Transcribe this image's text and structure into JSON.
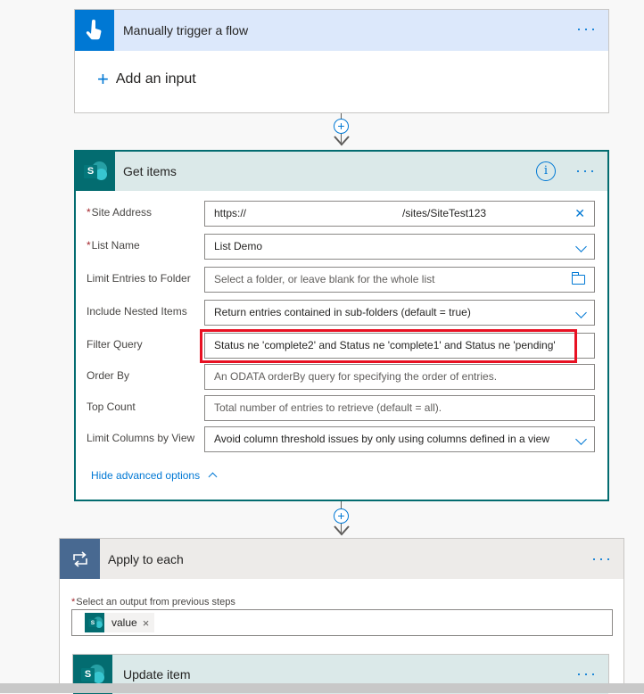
{
  "trigger": {
    "title": "Manually trigger a flow",
    "more": "···",
    "add_input_icon": "+",
    "add_input_label": "Add an input"
  },
  "connectors": {
    "plus": "+"
  },
  "get_items": {
    "title": "Get items",
    "info": "i",
    "more": "···",
    "fields": {
      "site_address": {
        "label": "Site Address",
        "value_prefix": "https://",
        "value_suffix": "/sites/SiteTest123"
      },
      "list_name": {
        "label": "List Name",
        "value": "List Demo"
      },
      "limit_folder": {
        "label": "Limit Entries to Folder",
        "placeholder": "Select a folder, or leave blank for the whole list"
      },
      "nested_items": {
        "label": "Include Nested Items",
        "value": "Return entries contained in sub-folders (default = true)"
      },
      "filter_query": {
        "label": "Filter Query",
        "value": "Status ne 'complete2' and Status ne 'complete1' and Status ne 'pending'"
      },
      "order_by": {
        "label": "Order By",
        "placeholder": "An ODATA orderBy query for specifying the order of entries."
      },
      "top_count": {
        "label": "Top Count",
        "placeholder": "Total number of entries to retrieve (default = all)."
      },
      "limit_columns": {
        "label": "Limit Columns by View",
        "value": "Avoid column threshold issues by only using columns defined in a view"
      }
    },
    "required_mark": "*",
    "hide_advanced": "Hide advanced options"
  },
  "apply_to_each": {
    "title": "Apply to each",
    "more": "···",
    "required_mark": "*",
    "output_label": "Select an output from previous steps",
    "token_label": "value",
    "token_remove": "×"
  },
  "update_item": {
    "title": "Update item",
    "more": "···"
  },
  "sharepoint_letter": "S",
  "colors": {
    "trigger_header": "#dce8fb",
    "trigger_icon": "#0078d4",
    "sharepoint": "#036c70",
    "sharepoint_header": "#dbe9e9",
    "loop_icon": "#486991",
    "highlight": "#e81123",
    "link": "#0078d4"
  }
}
